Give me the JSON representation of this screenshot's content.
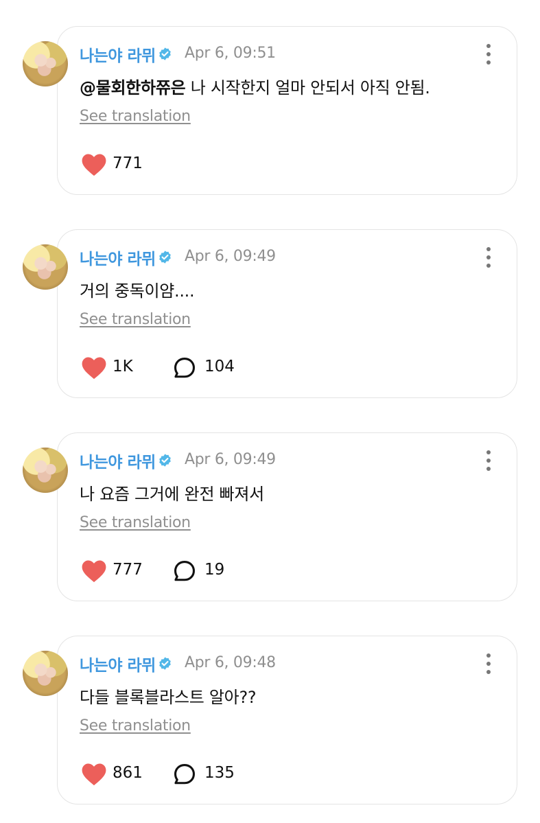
{
  "posts": [
    {
      "author": "나는야 라뮈",
      "date": "Apr 6, 09:51",
      "mention": "@물회한하쮸은",
      "text": " 나 시작한지 얼마 안되서 아직 안됨.",
      "translate_label": "See translation",
      "likes": "771",
      "comments": null
    },
    {
      "author": "나는야 라뮈",
      "date": "Apr 6, 09:49",
      "mention": "",
      "text": "거의 중독이얌....",
      "translate_label": "See translation",
      "likes": "1K",
      "comments": "104"
    },
    {
      "author": "나는야 라뮈",
      "date": "Apr 6, 09:49",
      "mention": "",
      "text": "나 요즘 그거에 완전 빠져서",
      "translate_label": "See translation",
      "likes": "777",
      "comments": "19"
    },
    {
      "author": "나는야 라뮈",
      "date": "Apr 6, 09:48",
      "mention": "",
      "text": "다들 블록블라스트 알아??",
      "translate_label": "See translation",
      "likes": "861",
      "comments": "135"
    }
  ],
  "icons": {
    "like": "heart-icon",
    "comment": "comment-bubble-icon",
    "verified": "verified-badge-icon",
    "more": "more-vertical-icon"
  },
  "colors": {
    "author": "#3f97de",
    "heart": "#ec5f5a",
    "verified": "#52b7e8",
    "muted": "#8f8f8f"
  }
}
